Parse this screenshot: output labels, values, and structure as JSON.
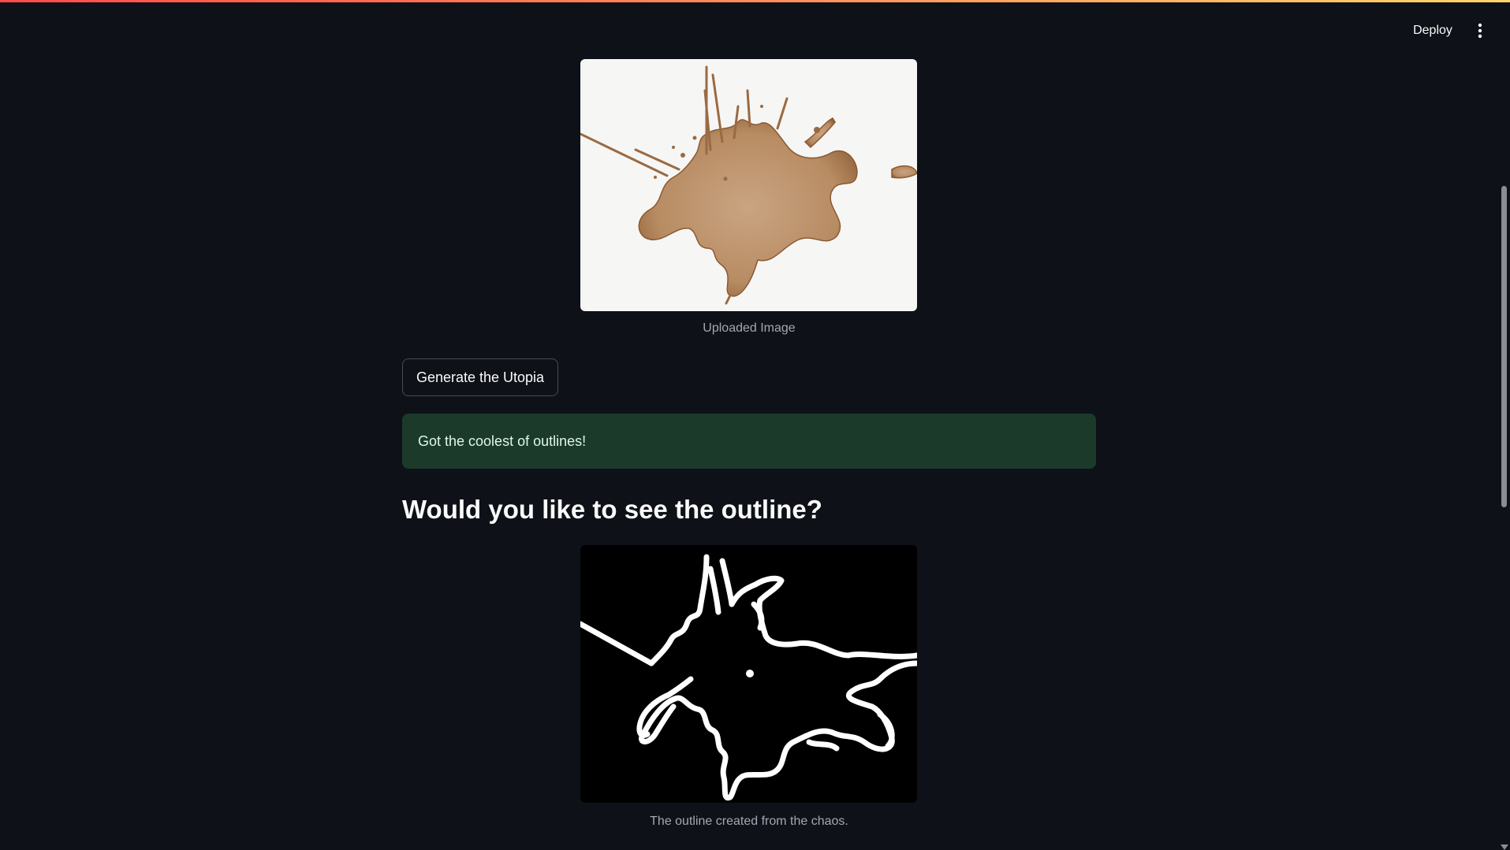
{
  "header": {
    "deploy_label": "Deploy",
    "menu_icon": "vertical-ellipsis-icon"
  },
  "uploaded": {
    "caption": "Uploaded Image"
  },
  "actions": {
    "generate_label": "Generate the Utopia"
  },
  "alert": {
    "message": "Got the coolest of outlines!",
    "color": "#1b3a2a"
  },
  "outline_section": {
    "heading": "Would you like to see the outline?",
    "caption": "The outline created from the chaos."
  },
  "theme": {
    "background": "#0e1117",
    "accent_gradient": [
      "#ff4b4b",
      "#ffd66b"
    ]
  }
}
